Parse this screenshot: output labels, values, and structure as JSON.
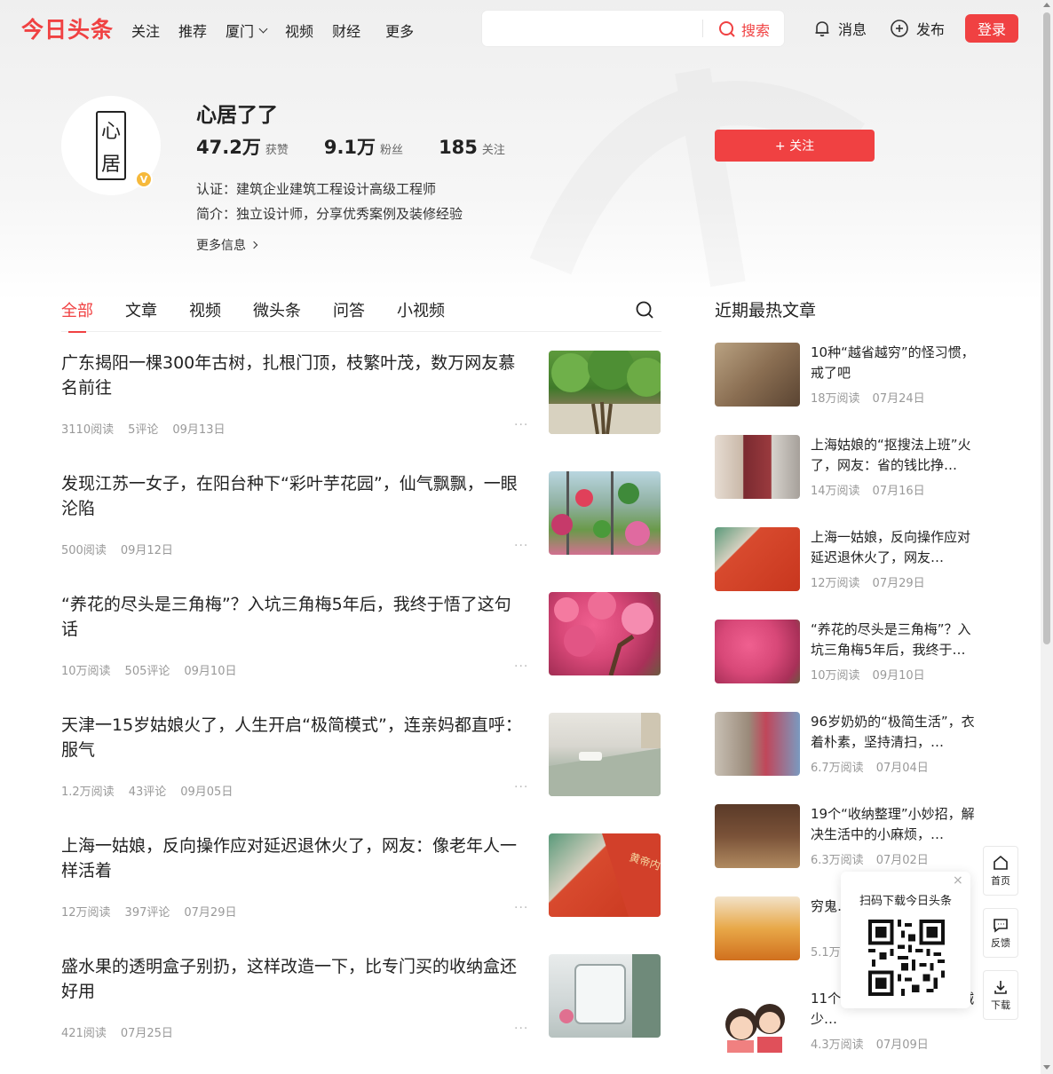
{
  "header": {
    "logo": "今日头条",
    "nav": [
      "关注",
      "推荐",
      "厦门",
      "视频",
      "财经",
      "更多"
    ],
    "search_placeholder": "",
    "search_button": "搜索",
    "messages": "消息",
    "publish": "发布",
    "login": "登录"
  },
  "profile": {
    "avatar_text": [
      "心",
      "居"
    ],
    "badge": "V",
    "name": "心居了了",
    "likes_num": "47.2万",
    "likes_label": "获赞",
    "fans_num": "9.1万",
    "fans_label": "粉丝",
    "following_num": "185",
    "following_label": "关注",
    "certification": "认证：建筑企业建筑工程设计高级工程师",
    "bio": "简介：独立设计师，分享优秀案例及装修经验",
    "more_info": "更多信息",
    "follow_button": "+ 关注"
  },
  "tabs": [
    "全部",
    "文章",
    "视频",
    "微头条",
    "问答",
    "小视频"
  ],
  "articles": [
    {
      "title": "广东揭阳一棵300年古树，扎根门顶，枝繁叶茂，数万网友慕名前往",
      "reads": "3110阅读",
      "comments": "5评论",
      "date": "09月13日"
    },
    {
      "title": "发现江苏一女子，在阳台种下“彩叶芋花园”，仙气飘飘，一眼沦陷",
      "reads": "500阅读",
      "comments": "",
      "date": "09月12日"
    },
    {
      "title": "“养花的尽头是三角梅”？入坑三角梅5年后，我终于悟了这句话",
      "reads": "10万阅读",
      "comments": "505评论",
      "date": "09月10日"
    },
    {
      "title": "天津一15岁姑娘火了，人生开启“极简模式”，连亲妈都直呼：服气",
      "reads": "1.2万阅读",
      "comments": "43评论",
      "date": "09月05日"
    },
    {
      "title": "上海一姑娘，反向操作应对延迟退休火了，网友：像老年人一样活着",
      "reads": "12万阅读",
      "comments": "397评论",
      "date": "07月29日"
    },
    {
      "title": "盛水果的透明盒子别扔，这样改造一下，比专门买的收纳盒还好用",
      "reads": "421阅读",
      "comments": "",
      "date": "07月25日"
    }
  ],
  "hot": {
    "title": "近期最热文章",
    "items": [
      {
        "title": "10种“越省越穷”的怪习惯，戒了吧",
        "reads": "18万阅读",
        "date": "07月24日"
      },
      {
        "title": "上海姑娘的“抠搜法上班”火了，网友：省的钱比挣…",
        "reads": "14万阅读",
        "date": "07月16日"
      },
      {
        "title": "上海一姑娘，反向操作应对延迟退休火了，网友…",
        "reads": "12万阅读",
        "date": "07月29日"
      },
      {
        "title": "“养花的尽头是三角梅”？入坑三角梅5年后，我终于…",
        "reads": "10万阅读",
        "date": "09月10日"
      },
      {
        "title": "96岁奶奶的“极简生活”，衣着朴素，坚持清扫，…",
        "reads": "6.7万阅读",
        "date": "07月04日"
      },
      {
        "title": "19个“收纳整理”小妙招，解决生活中的小麻烦，…",
        "reads": "6.3万阅读",
        "date": "07月02日"
      },
      {
        "title": "穷鬼…花钱…",
        "reads": "5.1万阅读",
        "date": ""
      },
      {
        "title": "11个…里久住不乱，家务减少…",
        "reads": "4.3万阅读",
        "date": "07月09日"
      }
    ]
  },
  "qr_popup": {
    "title": "扫码下载今日头条",
    "close": "×"
  },
  "side": {
    "home": "首页",
    "feedback": "反馈",
    "download": "下载"
  },
  "colors": {
    "accent": "#f04142",
    "badge": "#f6b93b"
  }
}
